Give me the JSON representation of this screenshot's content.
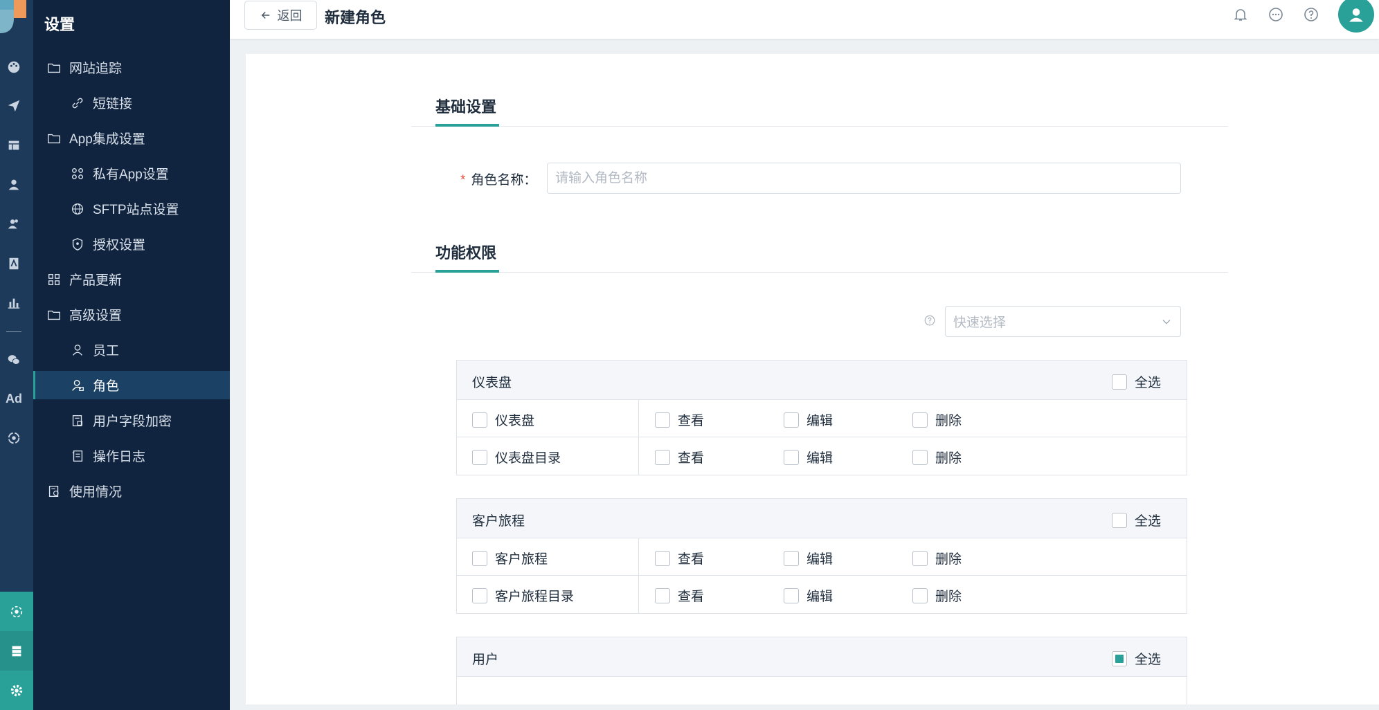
{
  "sidebar": {
    "title": "设置",
    "items": [
      {
        "label": "网站追踪",
        "icon": "folder-icon"
      },
      {
        "label": "短链接",
        "icon": "link-icon"
      },
      {
        "label": "App集成设置",
        "icon": "folder-icon"
      },
      {
        "label": "私有App设置",
        "icon": "command-icon"
      },
      {
        "label": "SFTP站点设置",
        "icon": "globe-icon"
      },
      {
        "label": "授权设置",
        "icon": "shield-icon"
      },
      {
        "label": "产品更新",
        "icon": "grid-icon"
      },
      {
        "label": "高级设置",
        "icon": "folder-icon"
      },
      {
        "label": "员工",
        "icon": "user-icon"
      },
      {
        "label": "角色",
        "icon": "user-role-icon"
      },
      {
        "label": "用户字段加密",
        "icon": "encrypt-icon"
      },
      {
        "label": "操作日志",
        "icon": "log-icon"
      },
      {
        "label": "使用情况",
        "icon": "usage-icon"
      }
    ]
  },
  "rail": {
    "ad_label": "Ad"
  },
  "header": {
    "back_label": "返回",
    "title": "新建角色"
  },
  "basic": {
    "tab_label": "基础设置",
    "role_name_label": "角色名称：",
    "required_mark": "*",
    "role_name_placeholder": "请输入角色名称",
    "role_name_value": ""
  },
  "perm": {
    "tab_label": "功能权限",
    "quick_select_placeholder": "快速选择",
    "select_all_label": "全选",
    "groups": [
      {
        "name": "仪表盘",
        "all_checked": false,
        "rows": [
          {
            "label": "仪表盘",
            "actions": [
              "查看",
              "编辑",
              "删除"
            ]
          },
          {
            "label": "仪表盘目录",
            "actions": [
              "查看",
              "编辑",
              "删除"
            ]
          }
        ]
      },
      {
        "name": "客户旅程",
        "all_checked": false,
        "rows": [
          {
            "label": "客户旅程",
            "actions": [
              "查看",
              "编辑",
              "删除"
            ]
          },
          {
            "label": "客户旅程目录",
            "actions": [
              "查看",
              "编辑",
              "删除"
            ]
          }
        ]
      },
      {
        "name": "用户",
        "all_checked": true,
        "rows": []
      }
    ]
  },
  "colors": {
    "accent": "#2aa198",
    "sidebar_bg": "#10243f",
    "rail_bg": "#1e3a5b",
    "required": "#e5533d"
  }
}
